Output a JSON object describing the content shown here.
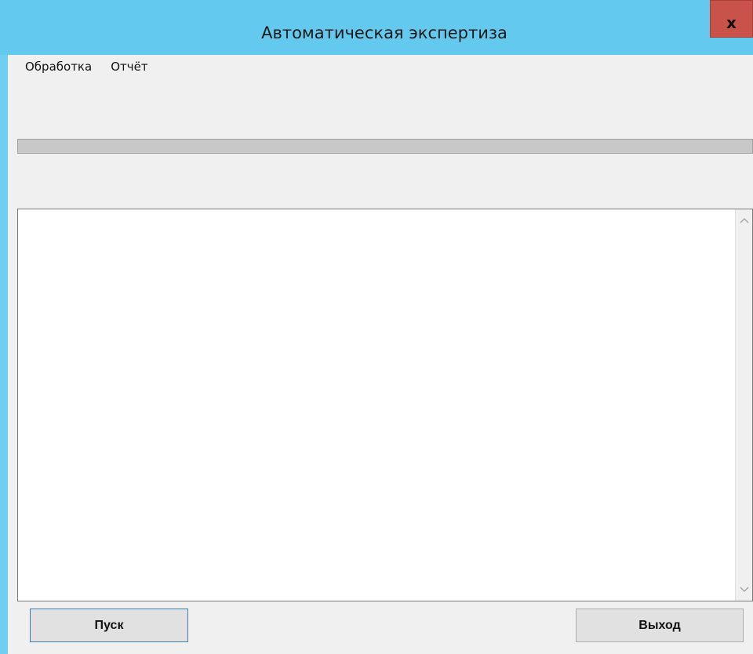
{
  "window": {
    "title": "Автоматическая экспертиза",
    "close_label": "x",
    "titlebar_color": "#64c9ee",
    "close_color": "#c9524a"
  },
  "menu": {
    "items": [
      {
        "label": "Обработка"
      },
      {
        "label": "Отчёт"
      }
    ]
  },
  "progress": {
    "value_percent": 0
  },
  "output": {
    "text": ""
  },
  "buttons": {
    "start_label": "Пуск",
    "exit_label": "Выход"
  },
  "icons": {
    "close": "close-icon",
    "scroll_up": "chevron-up-icon",
    "scroll_down": "chevron-down-icon"
  }
}
